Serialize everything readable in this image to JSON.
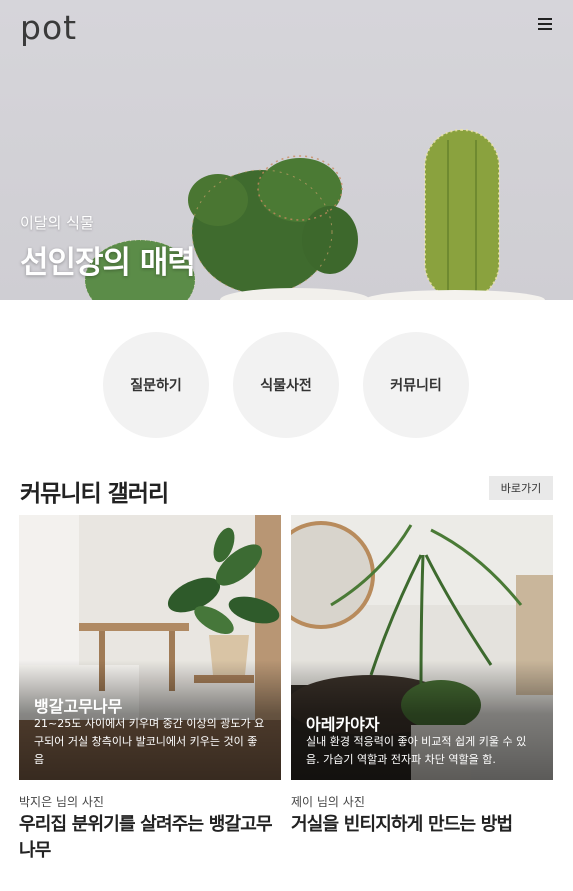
{
  "header": {
    "logo": "pot",
    "menu_icon": "hamburger-menu-icon"
  },
  "hero": {
    "subtitle": "이달의 식물",
    "title": "선인장의 매력"
  },
  "quick_menu": [
    {
      "label": "질문하기"
    },
    {
      "label": "식물사전"
    },
    {
      "label": "커뮤니티"
    }
  ],
  "gallery": {
    "title": "커뮤니티 갤러리",
    "goto_label": "바로가기",
    "cards": [
      {
        "title": "뱅갈고무나무",
        "description": "21~25도 사이에서 키우며 중간 이상의 광도가 요구되어 거실 창측이나 발코니에서 키우는 것이 좋음",
        "author": "박지은 님의 사진",
        "post_title": "우리집 분위기를 살려주는 뱅갈고무나무"
      },
      {
        "title": "아레카야자",
        "description": "실내 환경 적응력이 좋아 비교적 쉽게 키울 수 있음. 가습기 역할과 전자파 차단 역할을 함.",
        "author": "제이 님의 사진",
        "post_title": "거실을 빈티지하게 만드는 방법"
      }
    ]
  }
}
